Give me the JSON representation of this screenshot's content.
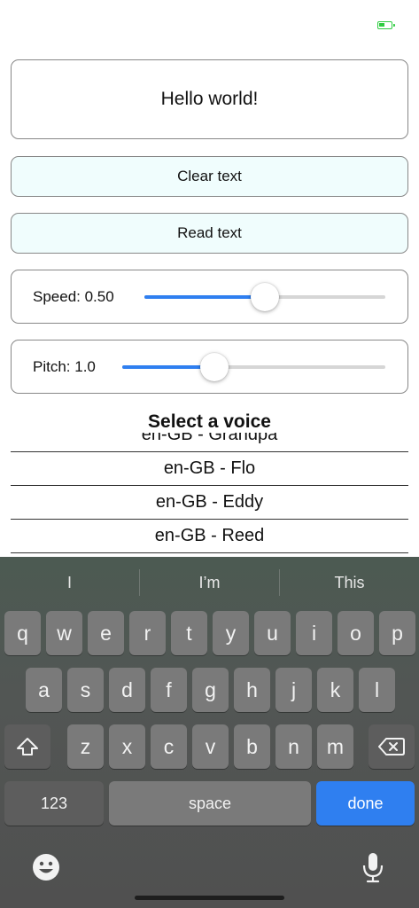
{
  "text_field": {
    "value": "Hello world!"
  },
  "buttons": {
    "clear": "Clear text",
    "read": "Read text"
  },
  "speed": {
    "label": "Speed: 0.50",
    "level": 0.5
  },
  "pitch": {
    "label": "Pitch: 1.0",
    "level": 0.35
  },
  "voice_picker": {
    "title": "Select a voice",
    "options": [
      "en-GB - Grandpa",
      "en-GB - Flo",
      "en-GB - Eddy",
      "en-GB - Reed"
    ]
  },
  "keyboard": {
    "suggestions": [
      "I",
      "I’m",
      "This"
    ],
    "row1": [
      "q",
      "w",
      "e",
      "r",
      "t",
      "y",
      "u",
      "i",
      "o",
      "p"
    ],
    "row2": [
      "a",
      "s",
      "d",
      "f",
      "g",
      "h",
      "j",
      "k",
      "l"
    ],
    "row3": [
      "z",
      "x",
      "c",
      "v",
      "b",
      "n",
      "m"
    ],
    "numbers_key": "123",
    "space_key": "space",
    "done_key": "done"
  },
  "colors": {
    "accent": "#2f7ff0",
    "button_bg": "#f0fdfd",
    "battery": "#2ecc40"
  },
  "icons": {
    "battery": "battery-charging-icon",
    "shift": "shift-arrow-icon",
    "delete": "backspace-icon",
    "emoji": "emoji-face-icon",
    "mic": "microphone-icon"
  }
}
